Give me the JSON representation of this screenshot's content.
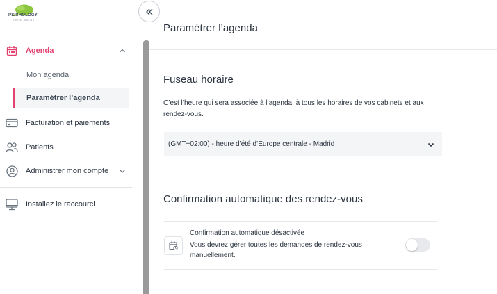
{
  "brand": {
    "name": "PSICHOLOGY",
    "tagline": "PORTAL ONLINE"
  },
  "colors": {
    "accent": "#e2406f",
    "text": "#2b3440",
    "muted": "#56606c",
    "panel": "#f4f5f7"
  },
  "sidebar": {
    "agenda": {
      "label": "Agenda",
      "icon": "calendar-icon",
      "expanded": true
    },
    "sub_items": [
      {
        "label": "Mon agenda",
        "active": false
      },
      {
        "label": "Paramétrer l’agenda",
        "active": true
      }
    ],
    "items": [
      {
        "label": "Facturation et paiements",
        "icon": "credit-card-icon"
      },
      {
        "label": "Patients",
        "icon": "users-icon"
      },
      {
        "label": "Administrer mon compte",
        "icon": "user-circle-icon",
        "has_chevron": true
      }
    ],
    "shortcut": {
      "label": "Installez le raccourci",
      "icon": "monitor-icon"
    }
  },
  "collapse": {
    "icon": "double-chevron-left-icon"
  },
  "main": {
    "title": "Paramétrer l’agenda",
    "timezone": {
      "title": "Fuseau horaire",
      "description": "C’est l’heure qui sera associée à l’agenda, à tous les horaires de vos cabinets et aux rendez-vous.",
      "selected": "(GMT+02:00) - heure d’été d’Europe centrale - Madrid"
    },
    "confirmation": {
      "title": "Confirmation automatique des rendez-vous",
      "status": "Confirmation automatique désactivée",
      "description": "Vous devrez gérer toutes les demandes de rendez-vous manuellement.",
      "enabled": false
    }
  }
}
